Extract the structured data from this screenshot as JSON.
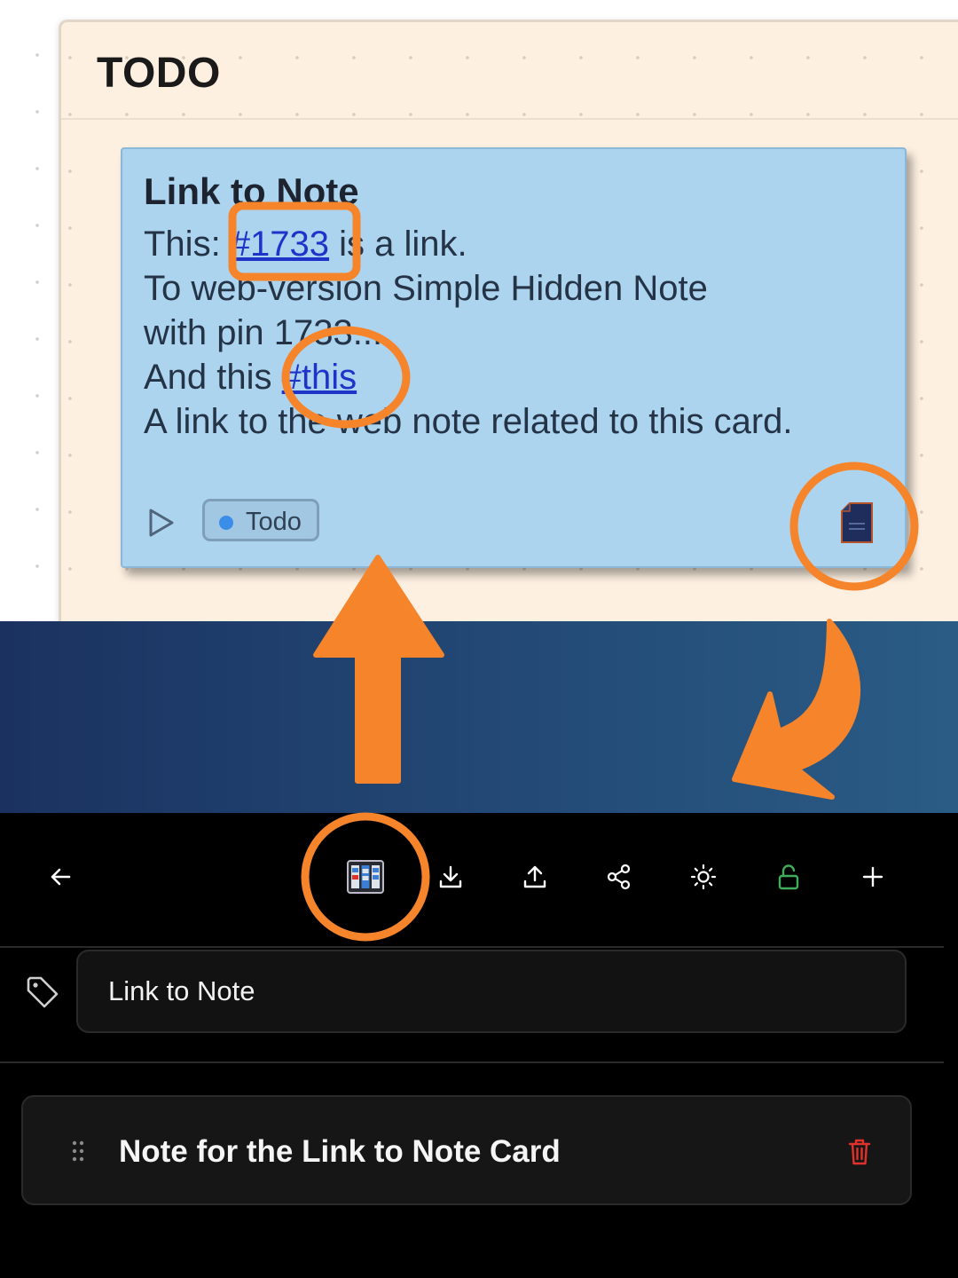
{
  "board": {
    "column_title": "TODO",
    "card": {
      "title": "Link to Note",
      "body": {
        "line1_prefix": "This: ",
        "line1_link": "#1733",
        "line1_suffix": " is a link.",
        "line2": "To web-version Simple Hidden Note",
        "line3": "with pin 1733...",
        "line4_prefix": "And this ",
        "line4_link": "#this",
        "line5": "A link to the web note related to this card."
      },
      "tag_label": "Todo",
      "tag_color": "#3a8de8",
      "background_color": "#add4ef"
    }
  },
  "toolbar": {
    "buttons": [
      "back-arrow-icon",
      "kanban-board-icon",
      "download-icon",
      "upload-icon",
      "share-icon",
      "brightness-icon",
      "unlock-icon",
      "plus-icon"
    ],
    "unlock_color": "#3fae5b"
  },
  "title_field": {
    "value": "Link to Note"
  },
  "notes": [
    {
      "label": "Note for the Link to Note Card"
    }
  ],
  "colors": {
    "annotation": "#f5842b",
    "delete": "#e0322b"
  }
}
